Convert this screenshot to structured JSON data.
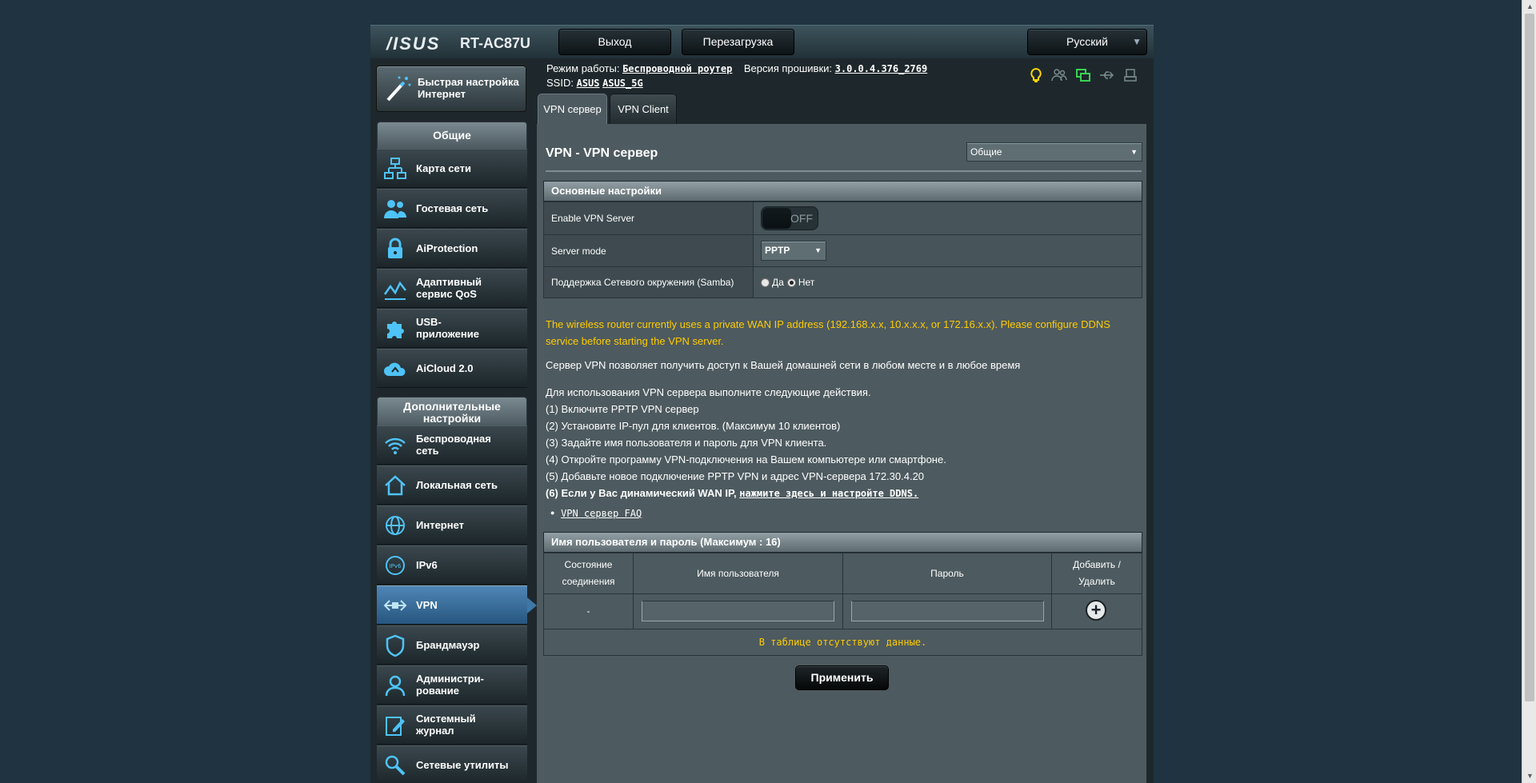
{
  "header": {
    "brand": "/ISUS",
    "model": "RT-AC87U",
    "logout_label": "Выход",
    "reboot_label": "Перезагрузка",
    "language": "Русский"
  },
  "status": {
    "mode_label": "Режим работы:",
    "mode_value": "Беспроводной роутер",
    "firmware_label": "Версия прошивки:",
    "firmware_value": "3.0.0.4.376_2769",
    "ssid_label": "SSID:",
    "ssid_1": "ASUS",
    "ssid_2": "ASUS_5G"
  },
  "sidebar": {
    "qis_label_1": "Быстрая настройка",
    "qis_label_2": "Интернет",
    "general_header": "Общие",
    "general_items": [
      {
        "label_1": "Карта сети",
        "label_2": ""
      },
      {
        "label_1": "Гостевая сеть",
        "label_2": ""
      },
      {
        "label_1": "AiProtection",
        "label_2": ""
      },
      {
        "label_1": "Адаптивный",
        "label_2": "сервис QoS"
      },
      {
        "label_1": "USB-",
        "label_2": "приложение"
      },
      {
        "label_1": "AiCloud 2.0",
        "label_2": ""
      }
    ],
    "advanced_header_1": "Дополнительные",
    "advanced_header_2": "настройки",
    "advanced_items": [
      {
        "label_1": "Беспроводная",
        "label_2": "сеть"
      },
      {
        "label_1": "Локальная сеть",
        "label_2": ""
      },
      {
        "label_1": "Интернет",
        "label_2": ""
      },
      {
        "label_1": "IPv6",
        "label_2": ""
      },
      {
        "label_1": "VPN",
        "label_2": ""
      },
      {
        "label_1": "Брандмауэр",
        "label_2": ""
      },
      {
        "label_1": "Администри-",
        "label_2": "рование"
      },
      {
        "label_1": "Системный",
        "label_2": "журнал"
      },
      {
        "label_1": "Сетевые утилиты",
        "label_2": ""
      }
    ]
  },
  "tabs": {
    "vpn_server": "VPN сервер",
    "vpn_client": "VPN Client"
  },
  "page": {
    "title": "VPN - VPN сервер",
    "view_select": "Общие"
  },
  "basic": {
    "header": "Основные настройки",
    "enable_label": "Enable VPN Server",
    "enable_state": "OFF",
    "server_mode_label": "Server mode",
    "server_mode_value": "PPTP",
    "samba_label": "Поддержка Сетевого окружения (Samba)",
    "samba_yes": "Да",
    "samba_no": "Нет"
  },
  "notes": {
    "warning_1": "The wireless router currently uses a private WAN IP address (192.168.x.x, 10.x.x.x, or 172.16.x.x). Please configure DDNS",
    "warning_2": "service before starting the VPN server.",
    "intro": "Сервер VPN позволяет получить доступ к Вашей домашней сети в любом месте и в любое время",
    "steps_head": "Для использования VPN сервера выполните следующие действия.",
    "step1": "(1) Включите PPTP VPN сервер",
    "step2": "(2) Установите IP-пул для клиентов. (Максимум 10 клиентов)",
    "step3": "(3) Задайте имя пользователя и пароль для VPN клиента.",
    "step4": "(4) Откройте программу VPN-подключения на Вашем компьютере или смартфоне.",
    "step5": "(5) Добавьте новое подключение PPTP VPN и адрес VPN-сервера 172.30.4.20",
    "step6_text": "(6) Если у Вас динамический WAN IP, ",
    "step6_link": "нажмите здесь и настройте DDNS.",
    "faq_link": "VPN сервер FAQ"
  },
  "users": {
    "header": "Имя пользователя и пароль (Максимум : 16)",
    "col_status_1": "Состояние",
    "col_status_2": "соединения",
    "col_username": "Имя пользователя",
    "col_password": "Пароль",
    "col_action_1": "Добавить /",
    "col_action_2": "Удалить",
    "new_row_status": "-",
    "username_value": "",
    "password_value": "",
    "no_data": "В таблице отсутствуют данные."
  },
  "apply_label": "Применить",
  "colors": {
    "warning": "#ffcc00",
    "active_menu": "#3e77a6",
    "status_yellow": "#ffd700",
    "status_green": "#39d353"
  }
}
